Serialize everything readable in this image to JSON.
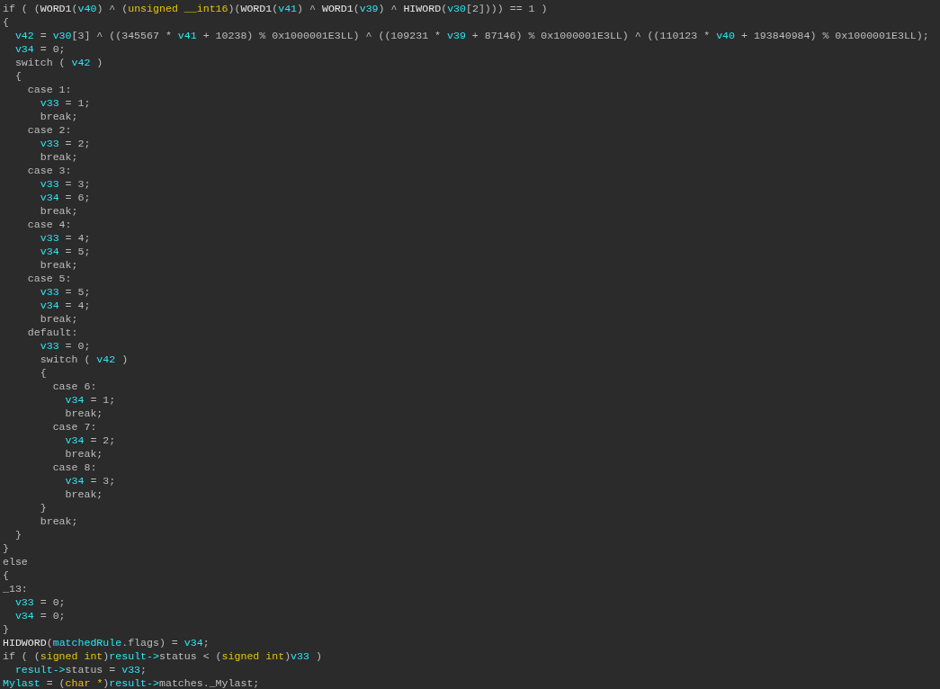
{
  "code_lines": [
    {
      "segments": [
        {
          "text": "if ( (",
          "kind": "plain"
        },
        {
          "text": "WORD1",
          "kind": "func"
        },
        {
          "text": "(",
          "kind": "plain"
        },
        {
          "text": "v40",
          "kind": "var"
        },
        {
          "text": ") ^ (",
          "kind": "plain"
        },
        {
          "text": "unsigned __int16",
          "kind": "type"
        },
        {
          "text": ")(",
          "kind": "plain"
        },
        {
          "text": "WORD1",
          "kind": "func"
        },
        {
          "text": "(",
          "kind": "plain"
        },
        {
          "text": "v41",
          "kind": "var"
        },
        {
          "text": ") ^ ",
          "kind": "plain"
        },
        {
          "text": "WORD1",
          "kind": "func"
        },
        {
          "text": "(",
          "kind": "plain"
        },
        {
          "text": "v39",
          "kind": "var"
        },
        {
          "text": ") ^ ",
          "kind": "plain"
        },
        {
          "text": "HIWORD",
          "kind": "func"
        },
        {
          "text": "(",
          "kind": "plain"
        },
        {
          "text": "v30",
          "kind": "var"
        },
        {
          "text": "[2]))) == 1 )",
          "kind": "plain"
        }
      ]
    },
    {
      "segments": [
        {
          "text": "{",
          "kind": "plain"
        }
      ]
    },
    {
      "segments": [
        {
          "text": "  v42",
          "kind": "var"
        },
        {
          "text": " = ",
          "kind": "plain"
        },
        {
          "text": "v30",
          "kind": "var"
        },
        {
          "text": "[3] ^ ((345567 * ",
          "kind": "plain"
        },
        {
          "text": "v41",
          "kind": "var"
        },
        {
          "text": " + 10238) % 0x1000001E3LL) ^ ((109231 * ",
          "kind": "plain"
        },
        {
          "text": "v39",
          "kind": "var"
        },
        {
          "text": " + 87146) % 0x1000001E3LL) ^ ((110123 * ",
          "kind": "plain"
        },
        {
          "text": "v40",
          "kind": "var"
        },
        {
          "text": " + 193840984) % 0x1000001E3LL);",
          "kind": "plain"
        }
      ]
    },
    {
      "segments": [
        {
          "text": "  v34",
          "kind": "var"
        },
        {
          "text": " = 0;",
          "kind": "plain"
        }
      ]
    },
    {
      "segments": [
        {
          "text": "  switch ( ",
          "kind": "plain"
        },
        {
          "text": "v42",
          "kind": "var"
        },
        {
          "text": " )",
          "kind": "plain"
        }
      ]
    },
    {
      "segments": [
        {
          "text": "  {",
          "kind": "plain"
        }
      ]
    },
    {
      "segments": [
        {
          "text": "    case 1:",
          "kind": "plain"
        }
      ]
    },
    {
      "segments": [
        {
          "text": "      v33",
          "kind": "var"
        },
        {
          "text": " = 1;",
          "kind": "plain"
        }
      ]
    },
    {
      "segments": [
        {
          "text": "      break;",
          "kind": "plain"
        }
      ]
    },
    {
      "segments": [
        {
          "text": "    case 2:",
          "kind": "plain"
        }
      ]
    },
    {
      "segments": [
        {
          "text": "      v33",
          "kind": "var"
        },
        {
          "text": " = 2;",
          "kind": "plain"
        }
      ]
    },
    {
      "segments": [
        {
          "text": "      break;",
          "kind": "plain"
        }
      ]
    },
    {
      "segments": [
        {
          "text": "    case 3:",
          "kind": "plain"
        }
      ]
    },
    {
      "segments": [
        {
          "text": "      v33",
          "kind": "var"
        },
        {
          "text": " = 3;",
          "kind": "plain"
        }
      ]
    },
    {
      "segments": [
        {
          "text": "      v34",
          "kind": "var"
        },
        {
          "text": " = 6;",
          "kind": "plain"
        }
      ]
    },
    {
      "segments": [
        {
          "text": "      break;",
          "kind": "plain"
        }
      ]
    },
    {
      "segments": [
        {
          "text": "    case 4:",
          "kind": "plain"
        }
      ]
    },
    {
      "segments": [
        {
          "text": "      v33",
          "kind": "var"
        },
        {
          "text": " = 4;",
          "kind": "plain"
        }
      ]
    },
    {
      "segments": [
        {
          "text": "      v34",
          "kind": "var"
        },
        {
          "text": " = 5;",
          "kind": "plain"
        }
      ]
    },
    {
      "segments": [
        {
          "text": "      break;",
          "kind": "plain"
        }
      ]
    },
    {
      "segments": [
        {
          "text": "    case 5:",
          "kind": "plain"
        }
      ]
    },
    {
      "segments": [
        {
          "text": "      v33",
          "kind": "var"
        },
        {
          "text": " = 5;",
          "kind": "plain"
        }
      ]
    },
    {
      "segments": [
        {
          "text": "      v34",
          "kind": "var"
        },
        {
          "text": " = 4;",
          "kind": "plain"
        }
      ]
    },
    {
      "segments": [
        {
          "text": "      break;",
          "kind": "plain"
        }
      ]
    },
    {
      "segments": [
        {
          "text": "    default:",
          "kind": "plain"
        }
      ]
    },
    {
      "segments": [
        {
          "text": "      v33",
          "kind": "var"
        },
        {
          "text": " = 0;",
          "kind": "plain"
        }
      ]
    },
    {
      "segments": [
        {
          "text": "      switch ( ",
          "kind": "plain"
        },
        {
          "text": "v42",
          "kind": "var"
        },
        {
          "text": " )",
          "kind": "plain"
        }
      ]
    },
    {
      "segments": [
        {
          "text": "      {",
          "kind": "plain"
        }
      ]
    },
    {
      "segments": [
        {
          "text": "        case 6:",
          "kind": "plain"
        }
      ]
    },
    {
      "segments": [
        {
          "text": "          v34",
          "kind": "var"
        },
        {
          "text": " = 1;",
          "kind": "plain"
        }
      ]
    },
    {
      "segments": [
        {
          "text": "          break;",
          "kind": "plain"
        }
      ]
    },
    {
      "segments": [
        {
          "text": "        case 7:",
          "kind": "plain"
        }
      ]
    },
    {
      "segments": [
        {
          "text": "          v34",
          "kind": "var"
        },
        {
          "text": " = 2;",
          "kind": "plain"
        }
      ]
    },
    {
      "segments": [
        {
          "text": "          break;",
          "kind": "plain"
        }
      ]
    },
    {
      "segments": [
        {
          "text": "        case 8:",
          "kind": "plain"
        }
      ]
    },
    {
      "segments": [
        {
          "text": "          v34",
          "kind": "var"
        },
        {
          "text": " = 3;",
          "kind": "plain"
        }
      ]
    },
    {
      "segments": [
        {
          "text": "          break;",
          "kind": "plain"
        }
      ]
    },
    {
      "segments": [
        {
          "text": "      }",
          "kind": "plain"
        }
      ]
    },
    {
      "segments": [
        {
          "text": "      break;",
          "kind": "plain"
        }
      ]
    },
    {
      "segments": [
        {
          "text": "  }",
          "kind": "plain"
        }
      ]
    },
    {
      "segments": [
        {
          "text": "}",
          "kind": "plain"
        }
      ]
    },
    {
      "segments": [
        {
          "text": "else",
          "kind": "plain"
        }
      ]
    },
    {
      "segments": [
        {
          "text": "{",
          "kind": "plain"
        }
      ]
    },
    {
      "segments": [
        {
          "text": "_13:",
          "kind": "plain"
        }
      ]
    },
    {
      "segments": [
        {
          "text": "  v33",
          "kind": "var"
        },
        {
          "text": " = 0;",
          "kind": "plain"
        }
      ]
    },
    {
      "segments": [
        {
          "text": "  v34",
          "kind": "var"
        },
        {
          "text": " = 0;",
          "kind": "plain"
        }
      ]
    },
    {
      "segments": [
        {
          "text": "}",
          "kind": "plain"
        }
      ]
    },
    {
      "segments": [
        {
          "text": "HIDWORD",
          "kind": "func"
        },
        {
          "text": "(",
          "kind": "plain"
        },
        {
          "text": "matchedRule",
          "kind": "var"
        },
        {
          "text": ".flags) = ",
          "kind": "plain"
        },
        {
          "text": "v34",
          "kind": "var"
        },
        {
          "text": ";",
          "kind": "plain"
        }
      ]
    },
    {
      "segments": [
        {
          "text": "if ( (",
          "kind": "plain"
        },
        {
          "text": "signed int",
          "kind": "type"
        },
        {
          "text": ")",
          "kind": "plain"
        },
        {
          "text": "result->",
          "kind": "var"
        },
        {
          "text": "status < (",
          "kind": "plain"
        },
        {
          "text": "signed int",
          "kind": "type"
        },
        {
          "text": ")",
          "kind": "plain"
        },
        {
          "text": "v33",
          "kind": "var"
        },
        {
          "text": " )",
          "kind": "plain"
        }
      ]
    },
    {
      "segments": [
        {
          "text": "  result->",
          "kind": "var"
        },
        {
          "text": "status = ",
          "kind": "plain"
        },
        {
          "text": "v33",
          "kind": "var"
        },
        {
          "text": ";",
          "kind": "plain"
        }
      ]
    },
    {
      "segments": [
        {
          "text": "Mylast",
          "kind": "var"
        },
        {
          "text": " = (",
          "kind": "plain"
        },
        {
          "text": "char *",
          "kind": "type"
        },
        {
          "text": ")",
          "kind": "plain"
        },
        {
          "text": "result->",
          "kind": "var"
        },
        {
          "text": "matches._Mylast;",
          "kind": "plain"
        }
      ]
    }
  ]
}
